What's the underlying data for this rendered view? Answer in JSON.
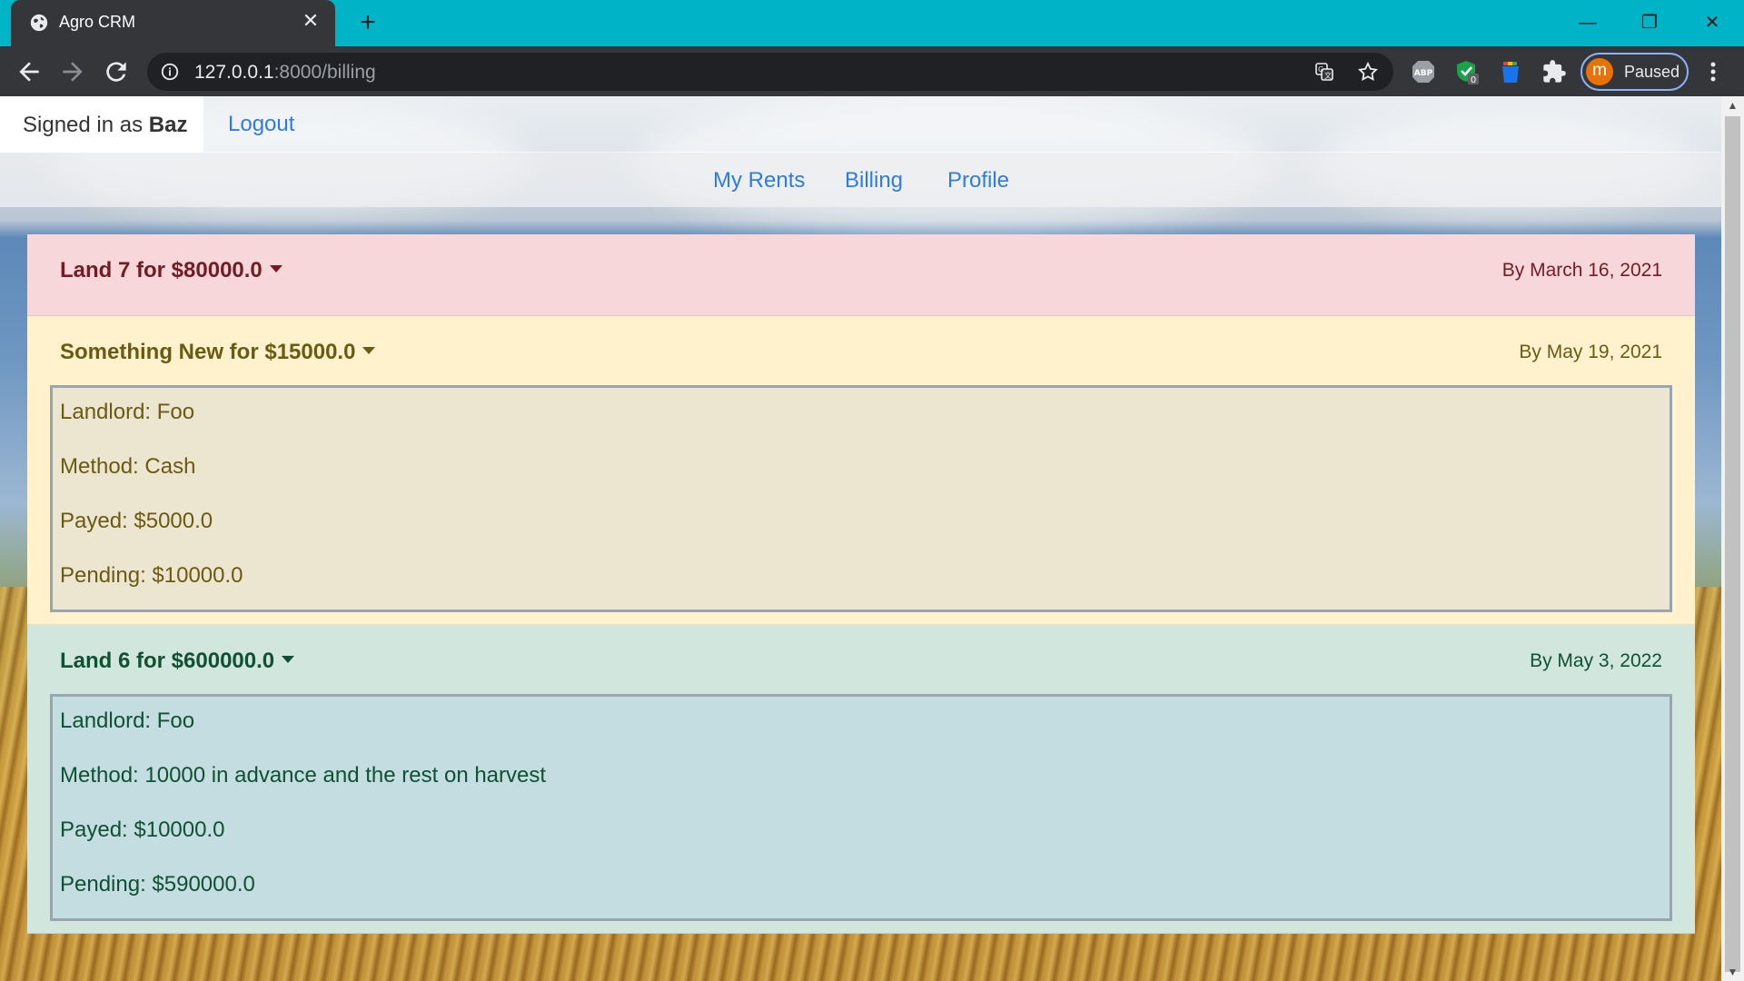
{
  "browser": {
    "tab_title": "Agro CRM",
    "url_host": "127.0.0.1",
    "url_path": ":8000/billing",
    "profile_initial": "m",
    "profile_status": "Paused",
    "extension_badge": "0",
    "abp_label": "ABP"
  },
  "userbar": {
    "signed_prefix": "Signed in as",
    "username": "Baz",
    "logout_label": "Logout"
  },
  "nav": {
    "items": [
      {
        "label": "My Rents"
      },
      {
        "label": "Billing"
      },
      {
        "label": "Profile"
      }
    ]
  },
  "billing": [
    {
      "title": "Land 7 for $80000.0",
      "date": "By March 16, 2021",
      "status": "danger",
      "expanded": false
    },
    {
      "title": "Something New for $15000.0",
      "date": "By May 19, 2021",
      "status": "warning",
      "expanded": true,
      "landlord": "Landlord: Foo",
      "method": "Method: Cash",
      "payed": "Payed: $5000.0",
      "pending": "Pending: $10000.0"
    },
    {
      "title": "Land 6 for $600000.0",
      "date": "By May 3, 2022",
      "status": "success",
      "expanded": true,
      "landlord": "Landlord: Foo",
      "method": "Method: 10000 in advance and the rest on harvest",
      "payed": "Payed: $10000.0",
      "pending": "Pending: $590000.0"
    }
  ],
  "colors": {
    "tabbar": "#00b3c7",
    "chrome": "#35363a",
    "link": "#2f7ce0",
    "danger_bg": "#f8d7da",
    "warning_bg": "#fff2cc",
    "success_bg": "#d1e7dd"
  }
}
